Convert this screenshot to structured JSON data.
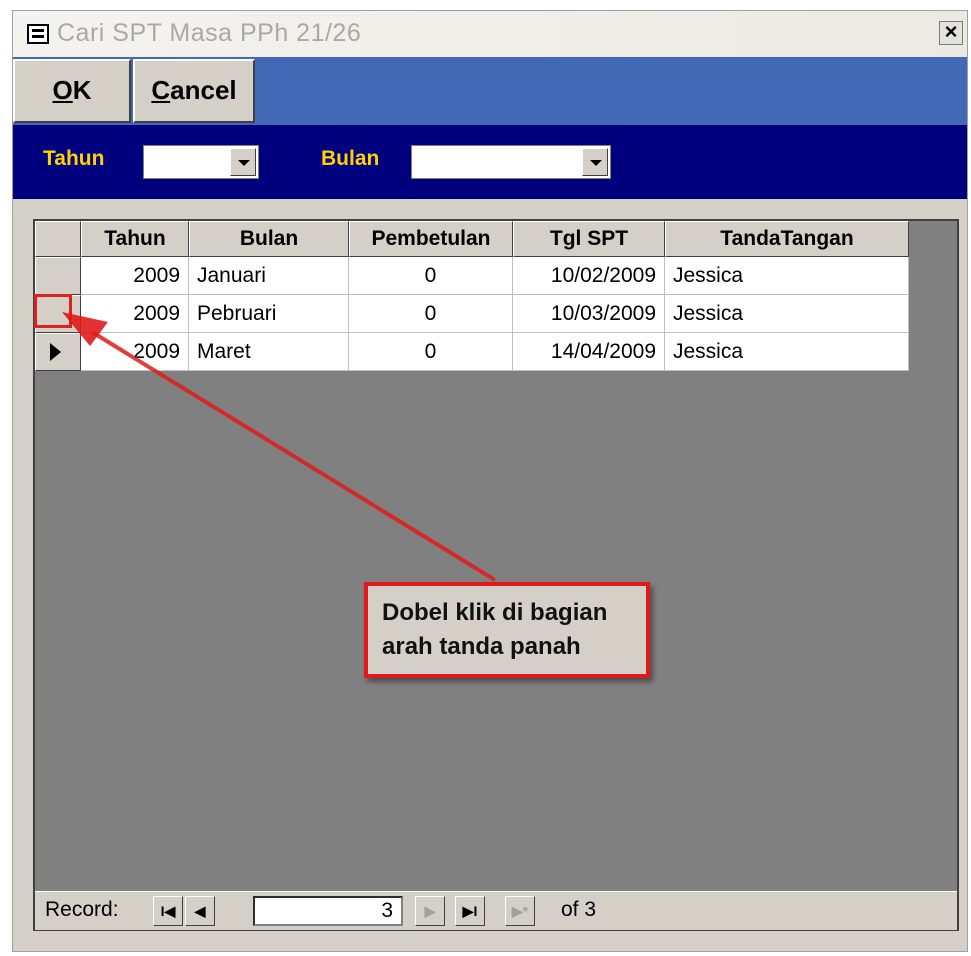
{
  "window": {
    "title": "Cari SPT Masa PPh 21/26",
    "close_label": "×"
  },
  "toolbar": {
    "ok": {
      "hotkey": "O",
      "rest": "K"
    },
    "cancel": {
      "hotkey": "C",
      "rest": "ancel"
    }
  },
  "filters": {
    "tahun_label": "Tahun",
    "tahun_value": "",
    "bulan_label": "Bulan",
    "bulan_value": ""
  },
  "table": {
    "columns": [
      "Tahun",
      "Bulan",
      "Pembetulan",
      "Tgl SPT",
      "TandaTangan"
    ],
    "rows": [
      [
        "2009",
        "Januari",
        "0",
        "10/02/2009",
        "Jessica"
      ],
      [
        "2009",
        "Pebruari",
        "0",
        "10/03/2009",
        "Jessica"
      ],
      [
        "2009",
        "Maret",
        "0",
        "14/04/2009",
        "Jessica"
      ]
    ]
  },
  "navigation": {
    "record_label": "Record:",
    "current": "3",
    "of_label": "of  3",
    "buttons": {
      "first": "I◀",
      "prev": "◀",
      "next": "▶",
      "last": "▶I",
      "new": "▶*"
    }
  },
  "callout": {
    "line1": "Dobel klik di bagian",
    "line2": "arah tanda panah"
  },
  "colors": {
    "accent": "#00007f",
    "toolbar": "#4169b6",
    "label": "#ffd200",
    "annotation": "#e01a1a"
  }
}
